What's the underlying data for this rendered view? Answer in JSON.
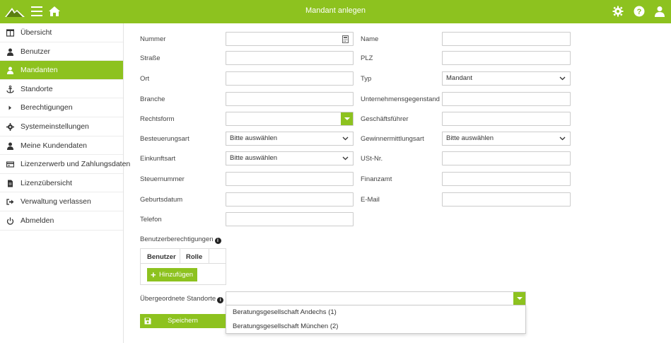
{
  "header": {
    "title": "Mandant anlegen",
    "brand_color": "#8dc21f"
  },
  "sidebar": {
    "items": [
      {
        "label": "Übersicht",
        "icon": "columns-icon"
      },
      {
        "label": "Benutzer",
        "icon": "user-icon"
      },
      {
        "label": "Mandanten",
        "icon": "user-icon",
        "active": true
      },
      {
        "label": "Standorte",
        "icon": "anchor-icon"
      },
      {
        "label": "Berechtigungen",
        "icon": "caret-right-icon"
      },
      {
        "label": "Systemeinstellungen",
        "icon": "gear-icon"
      },
      {
        "label": "Meine Kundendaten",
        "icon": "user-icon"
      },
      {
        "label": "Lizenzerwerb und Zahlungsdaten",
        "icon": "credit-card-icon"
      },
      {
        "label": "Lizenzübersicht",
        "icon": "file-icon"
      },
      {
        "label": "Verwaltung verlassen",
        "icon": "sign-out-icon"
      },
      {
        "label": "Abmelden",
        "icon": "power-icon"
      }
    ]
  },
  "form": {
    "nummer": "Nummer",
    "name": "Name",
    "strasse": "Straße",
    "plz": "PLZ",
    "ort": "Ort",
    "typ": "Typ",
    "typ_value": "Mandant",
    "branche": "Branche",
    "unternehmensgegenstand": "Unternehmensgegenstand",
    "rechtsform": "Rechtsform",
    "geschaeftsfuehrer": "Geschäftsführer",
    "besteuerungsart": "Besteuerungsart",
    "besteuerungsart_value": "Bitte auswählen",
    "gewinnermittlungsart": "Gewinnermittlungsart",
    "gewinnermittlungsart_value": "Bitte auswählen",
    "einkunftsart": "Einkunftsart",
    "einkunftsart_value": "Bitte auswählen",
    "ustnr": "USt-Nr.",
    "steuernummer": "Steuernummer",
    "finanzamt": "Finanzamt",
    "geburtsdatum": "Geburtsdatum",
    "email": "E-Mail",
    "telefon": "Telefon",
    "benutzerberechtigungen": "Benutzerberechtigungen",
    "perm_col_benutzer": "Benutzer",
    "perm_col_rolle": "Rolle",
    "hinzufuegen": "Hinzufügen",
    "uebergeordnete_standorte": "Übergeordnete Standorte",
    "standorte_options": [
      "Beratungsgesellschaft Andechs (1)",
      "Beratungsgesellschaft München (2)"
    ],
    "speichern": "Speichern"
  }
}
